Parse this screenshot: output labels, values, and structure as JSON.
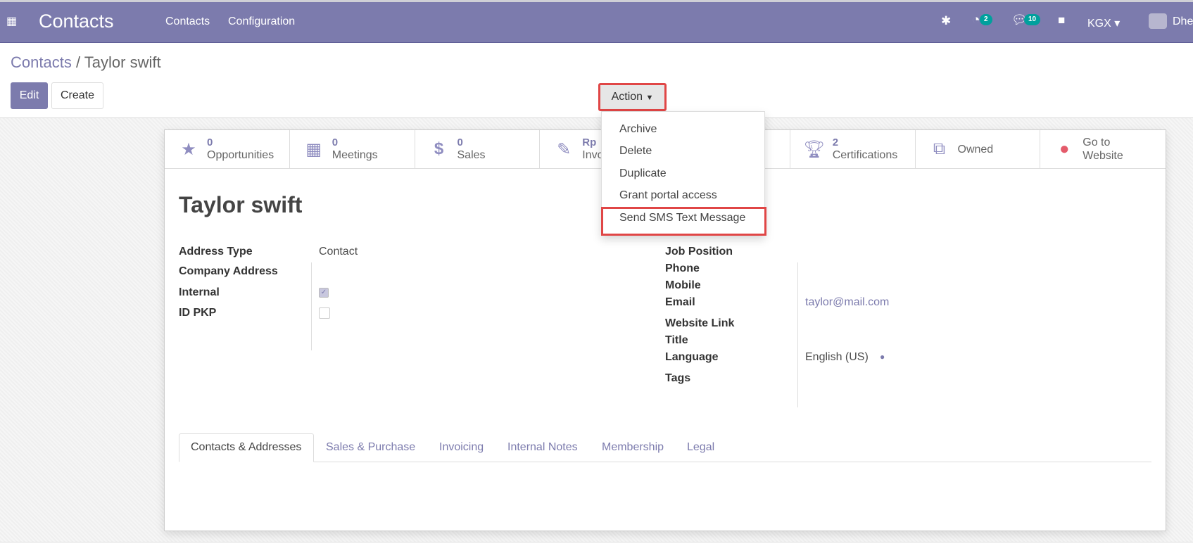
{
  "navbar": {
    "app_title": "Contacts",
    "menu": [
      "Contacts",
      "Configuration"
    ],
    "activity_count": "2",
    "message_count": "10",
    "company": "KGX",
    "user": "Dhe",
    "color": "#7c7bad"
  },
  "breadcrumb": {
    "parent": "Contacts",
    "separator": "/",
    "current": "Taylor swift"
  },
  "buttons": {
    "edit": "Edit",
    "create": "Create",
    "action": "Action"
  },
  "action_menu": [
    "Archive",
    "Delete",
    "Duplicate",
    "Grant portal access",
    "Send SMS Text Message"
  ],
  "highlight_color": "#e04646",
  "smart_buttons": [
    {
      "icon": "star-icon",
      "value": "0",
      "label": "Opportunities"
    },
    {
      "icon": "calendar-icon",
      "value": "0",
      "label": "Meetings"
    },
    {
      "icon": "dollar-icon",
      "value": "0",
      "label": "Sales"
    },
    {
      "icon": "edit-icon",
      "value": "Rp",
      "label": "Invo"
    },
    {
      "icon": "",
      "value": "",
      "label": ""
    },
    {
      "icon": "trophy-icon",
      "value": "2",
      "label": "Certifications"
    },
    {
      "icon": "sitemap-icon",
      "value": "",
      "label": "Owned"
    },
    {
      "icon": "globe-icon",
      "value": "",
      "label": "Go to Website"
    }
  ],
  "record": {
    "name": "Taylor swift"
  },
  "left_fields": [
    {
      "label": "Address Type",
      "value": "Contact"
    },
    {
      "label": "Company Address",
      "value": ""
    },
    {
      "label": "Internal",
      "checked": true
    },
    {
      "label": "ID PKP",
      "checked": false
    }
  ],
  "right_fields": [
    {
      "label": "Job Position",
      "value": ""
    },
    {
      "label": "Phone",
      "value": ""
    },
    {
      "label": "Mobile",
      "value": ""
    },
    {
      "label": "Email",
      "value": "taylor@mail.com"
    },
    {
      "label": "Website Link",
      "value": ""
    },
    {
      "label": "Title",
      "value": ""
    },
    {
      "label": "Language",
      "value": "English (US)"
    },
    {
      "label": "Tags",
      "value": ""
    }
  ],
  "tabs": [
    "Contacts & Addresses",
    "Sales & Purchase",
    "Invoicing",
    "Internal Notes",
    "Membership",
    "Legal"
  ],
  "active_tab": "Contacts & Addresses"
}
